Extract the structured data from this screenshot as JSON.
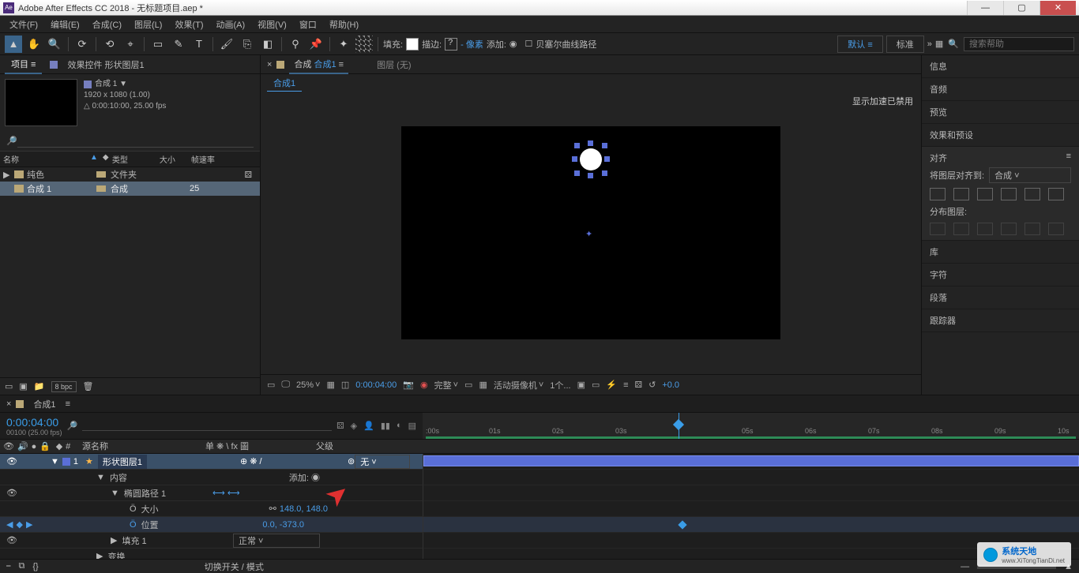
{
  "title": "Adobe After Effects CC 2018 - 无标题项目.aep *",
  "menu": [
    "文件(F)",
    "编辑(E)",
    "合成(C)",
    "图层(L)",
    "效果(T)",
    "动画(A)",
    "视图(V)",
    "窗口",
    "帮助(H)"
  ],
  "toolbar": {
    "fill_label": "填充:",
    "stroke_label": "描边:",
    "px_label": "- 像素",
    "add_label": "添加: ",
    "bezier": "贝塞尔曲线路径",
    "ws_default": "默认 ≡",
    "ws_standard": "标准",
    "search_ph": "搜索帮助"
  },
  "project": {
    "tab_project": "项目 ≡",
    "tab_ec": "效果控件 形状图层1",
    "comp_name": "合成 1 ▼",
    "res": "1920 x 1080 (1.00)",
    "dur": "△ 0:00:10:00, 25.00 fps",
    "search_ph": "",
    "cols": {
      "name": "名称",
      "type": "类型",
      "size": "大小",
      "fps": "帧速率"
    },
    "rows": [
      {
        "name": "纯色",
        "type": "文件夹",
        "fps": ""
      },
      {
        "name": "合成 1",
        "type": "合成",
        "fps": "25"
      }
    ],
    "bpc": "8 bpc"
  },
  "viewer": {
    "tab_layout": "■",
    "tab_comp": "合成 合成1 ≡",
    "layer_none": "图层 (无)",
    "sub_tab": "合成1",
    "accel": "显示加速已禁用",
    "zoom": "25%",
    "time": "0:00:04:00",
    "res": "完整",
    "camera": "活动摄像机",
    "view": "1个...",
    "exposure": "+0.0"
  },
  "right": {
    "info": "信息",
    "audio": "音频",
    "preview": "预览",
    "effects": "效果和预设",
    "align": "对齐",
    "align_to_label": "将图层对齐到:",
    "align_to": "合成",
    "distribute": "分布图层:",
    "library": "库",
    "character": "字符",
    "paragraph": "段落",
    "tracker": "跟踪器"
  },
  "timeline": {
    "tab": "合成1",
    "timecode": "0:00:04:00",
    "timecode_sub": "00100 (25.00 fps)",
    "search_ph": "",
    "cols": {
      "eye": "",
      "source": "源名称",
      "switches": "单 ❋ \\ fx 圖",
      "parent": "父级"
    },
    "ticks": [
      ":00s",
      "01s",
      "02s",
      "03s",
      "05s",
      "06s",
      "07s",
      "08s",
      "09s",
      "10s"
    ],
    "layer": {
      "num": "1",
      "name": "形状图层1",
      "parent": "无"
    },
    "props": {
      "contents": "内容",
      "add": "添加: ",
      "ellipse": "椭圆路径 1",
      "size": "大小",
      "size_val": "148.0, 148.0",
      "position": "位置",
      "pos_val": "0.0, -373.0",
      "fill": "填充 1",
      "fill_mode": "正常",
      "transform": "变换"
    },
    "footer": "切换开关 / 模式"
  },
  "watermark": {
    "brand": "系统天地",
    "url": "www.XiTongTianDi.net"
  }
}
